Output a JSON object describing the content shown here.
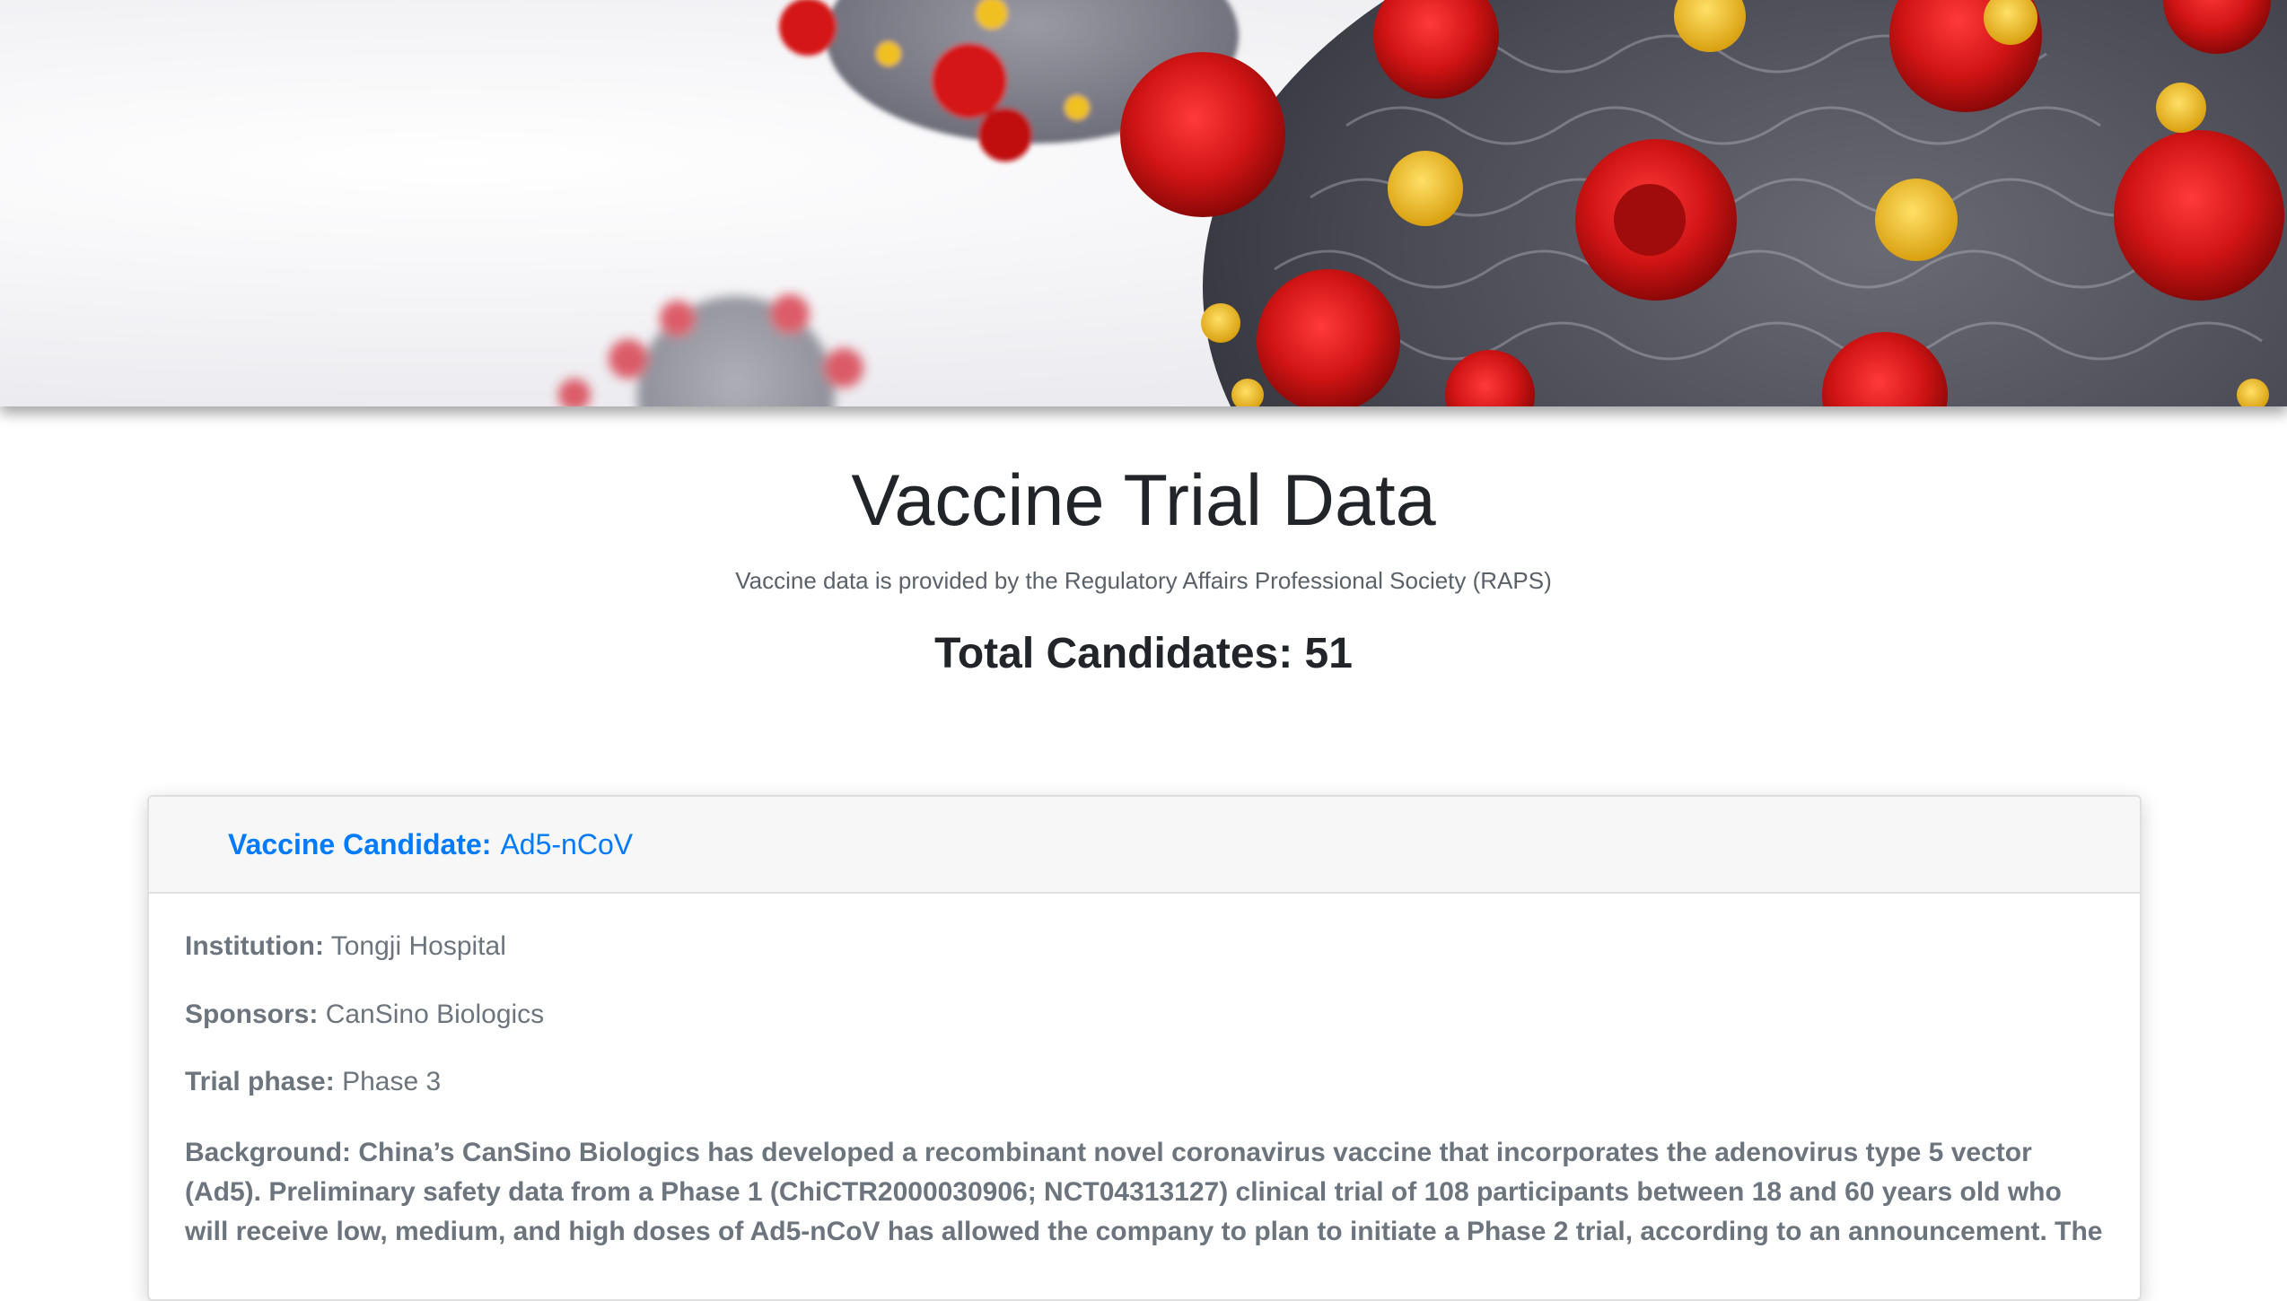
{
  "hero": {
    "image_name": "coronavirus-hero-image"
  },
  "page": {
    "title": "Vaccine Trial Data",
    "subtitle": "Vaccine data is provided by the Regulatory Affairs Professional Society (RAPS)",
    "total_label": "Total Candidates: 51"
  },
  "card": {
    "candidate_key": "Vaccine Candidate:",
    "candidate_value": "Ad5-nCoV",
    "fields": {
      "institution_key": "Institution:",
      "institution_value": "Tongji Hospital",
      "sponsors_key": "Sponsors:",
      "sponsors_value": "CanSino Biologics",
      "phase_key": "Trial phase:",
      "phase_value": "Phase 3"
    },
    "background": "Background: China’s CanSino Biologics has developed a recombinant novel coronavirus vaccine that incorporates the adenovirus type 5 vector (Ad5). Preliminary safety data from a Phase 1 (ChiCTR2000030906; NCT04313127) clinical trial of 108 participants between 18 and 60 years old who will receive low, medium, and high doses of Ad5-nCoV has allowed the company to plan to initiate a Phase 2 trial, according to an announcement. The"
  },
  "colors": {
    "link_blue": "#007bff",
    "muted_text": "#6c757d",
    "virus_red": "#d01818",
    "virus_yellow": "#f2c01c",
    "virus_gray": "#55555f"
  }
}
